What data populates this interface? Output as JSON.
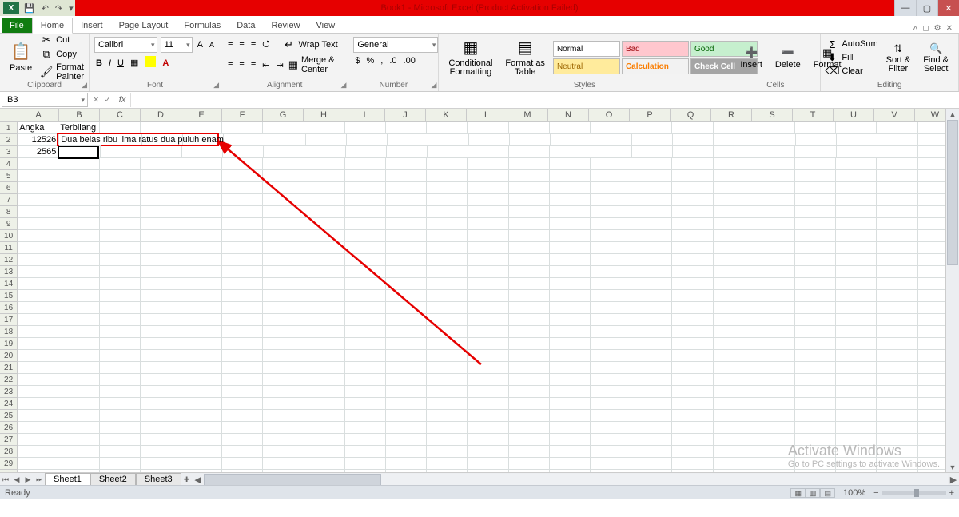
{
  "title": "Book1 - Microsoft Excel (Product Activation Failed)",
  "qat": {
    "save": "💾",
    "undo": "↶",
    "redo": "↷"
  },
  "tabs": {
    "file": "File",
    "home": "Home",
    "insert": "Insert",
    "pagelayout": "Page Layout",
    "formulas": "Formulas",
    "data": "Data",
    "review": "Review",
    "view": "View"
  },
  "ribbon": {
    "clipboard": {
      "paste": "Paste",
      "cut": "Cut",
      "copy": "Copy",
      "fmtpainter": "Format Painter",
      "label": "Clipboard"
    },
    "font": {
      "name": "Calibri",
      "size": "11",
      "label": "Font"
    },
    "alignment": {
      "wrap": "Wrap Text",
      "merge": "Merge & Center",
      "label": "Alignment"
    },
    "number": {
      "format": "General",
      "label": "Number"
    },
    "styles": {
      "cond": "Conditional\nFormatting",
      "fat": "Format as\nTable",
      "n": "Normal",
      "bad": "Bad",
      "good": "Good",
      "neutral": "Neutral",
      "calc": "Calculation",
      "check": "Check Cell",
      "label": "Styles"
    },
    "cells": {
      "insert": "Insert",
      "delete": "Delete",
      "format": "Format",
      "label": "Cells"
    },
    "editing": {
      "autosum": "AutoSum",
      "fill": "Fill",
      "clear": "Clear",
      "sort": "Sort &\nFilter",
      "find": "Find &\nSelect",
      "label": "Editing"
    }
  },
  "namebox": "B3",
  "columns": [
    "A",
    "B",
    "C",
    "D",
    "E",
    "F",
    "G",
    "H",
    "I",
    "J",
    "K",
    "L",
    "M",
    "N",
    "O",
    "P",
    "Q",
    "R",
    "S",
    "T",
    "U",
    "V",
    "W"
  ],
  "cells": {
    "A1": "Angka",
    "B1": "Terbilang",
    "A2": "12526",
    "B2": "Dua belas ribu lima ratus dua puluh enam",
    "A3": "2565"
  },
  "sheets": [
    "Sheet1",
    "Sheet2",
    "Sheet3"
  ],
  "status": {
    "ready": "Ready",
    "zoom": "100%"
  },
  "watermark": {
    "title": "Activate Windows",
    "sub": "Go to PC settings to activate Windows."
  }
}
